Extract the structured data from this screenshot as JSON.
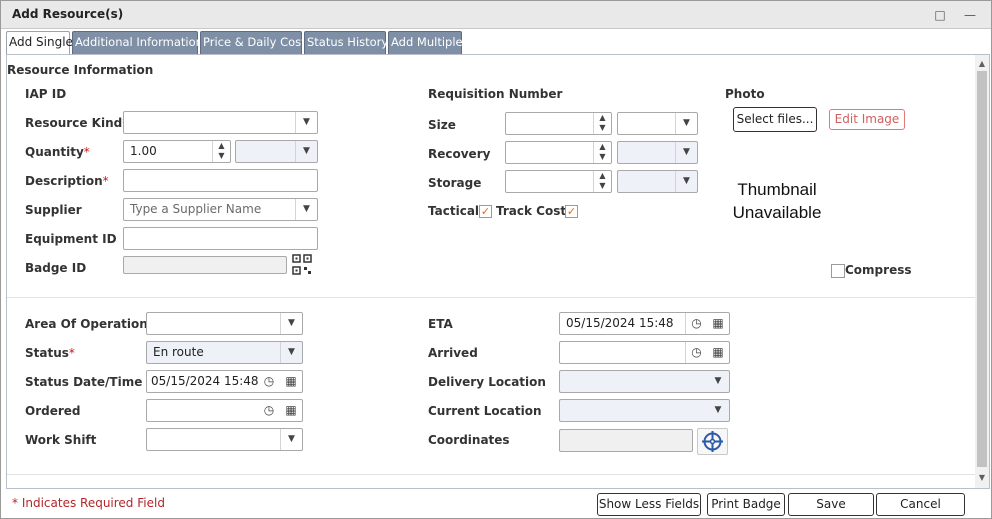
{
  "window": {
    "title": "Add Resource(s)",
    "maximize_icon": "maximize-icon",
    "minimize_icon": "minimize-icon"
  },
  "tabs": [
    {
      "label": "Add Single",
      "active": true
    },
    {
      "label": "Additional Information",
      "active": false
    },
    {
      "label": "Price & Daily Cost",
      "active": false
    },
    {
      "label": "Status History",
      "active": false
    },
    {
      "label": "Add Multiple",
      "active": false
    }
  ],
  "resource_info": {
    "section_title": "Resource Information",
    "iap_id_label": "IAP ID",
    "resource_kind_label": "Resource Kind",
    "resource_kind_value": "",
    "quantity_label": "Quantity",
    "quantity_value": "1.00",
    "quantity_unit_value": "",
    "description_label": "Description",
    "description_value": "",
    "supplier_label": "Supplier",
    "supplier_placeholder": "Type a Supplier Name",
    "equipment_id_label": "Equipment ID",
    "equipment_id_value": "",
    "badge_id_label": "Badge ID",
    "badge_id_value": "",
    "required_mark": "*"
  },
  "requisition": {
    "requisition_number_label": "Requisition Number",
    "size_label": "Size",
    "recovery_label": "Recovery",
    "storage_label": "Storage",
    "tactical_label": "Tactical",
    "tactical_checked": true,
    "track_cost_label": "Track Cost",
    "track_cost_checked": true,
    "check_glyph": "✓"
  },
  "photo": {
    "label": "Photo",
    "select_files_label": "Select files...",
    "edit_image_label": "Edit Image",
    "thumbnail_line1": "Thumbnail",
    "thumbnail_line2": "Unavailable",
    "compress_label": "Compress",
    "compress_checked": false
  },
  "operation": {
    "area_label": "Area Of Operation",
    "area_value": "",
    "status_label": "Status",
    "status_value": "En route",
    "status_datetime_label": "Status Date/Time",
    "status_datetime_value": "05/15/2024 15:48",
    "ordered_label": "Ordered",
    "ordered_value": "",
    "work_shift_label": "Work Shift",
    "work_shift_value": ""
  },
  "logistics": {
    "eta_label": "ETA",
    "eta_value": "05/15/2024 15:48",
    "arrived_label": "Arrived",
    "arrived_value": "",
    "delivery_location_label": "Delivery Location",
    "delivery_location_value": "",
    "current_location_label": "Current Location",
    "current_location_value": "",
    "coordinates_label": "Coordinates",
    "coordinates_value": ""
  },
  "footer": {
    "required_note": "* Indicates Required Field",
    "show_less_label": "Show Less Fields",
    "print_badge_label": "Print Badge",
    "save_label": "Save",
    "cancel_label": "Cancel"
  },
  "glyphs": {
    "dropdown_arrow": "▼",
    "spin_up": "▲",
    "spin_down": "▼",
    "clock": "◷",
    "calendar": "▦",
    "scroll_up": "▲",
    "scroll_down": "▼",
    "maximize": "□",
    "minimize": "—"
  }
}
